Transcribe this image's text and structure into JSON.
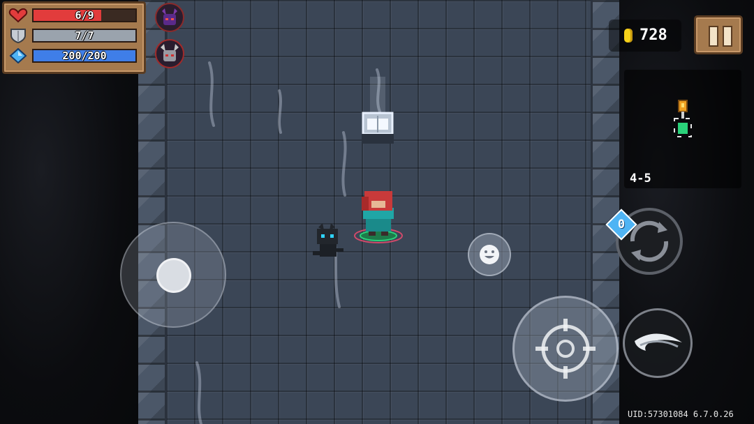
{
  "hud": {
    "health": {
      "text": "6/9",
      "current": 6,
      "max": 9,
      "color": "#e23c3c"
    },
    "armor": {
      "text": "7/7",
      "current": 7,
      "max": 7,
      "color": "#9aa3ad"
    },
    "energy": {
      "text": "200/200",
      "current": 200,
      "max": 200,
      "color": "#3f7ee8"
    },
    "buffs": [
      "purple-demon-helmet-icon",
      "grey-horned-helmet-icon"
    ]
  },
  "coins": {
    "count": "728",
    "icon": "gold-coin-icon",
    "color": "#f6d21a"
  },
  "pause": {
    "icon": "pause-icon"
  },
  "minimap": {
    "level": "4-5"
  },
  "controls": {
    "joystick": "movement-joystick",
    "emote": "smiley-face-icon",
    "weapon_swap": "swap-arrows-icon",
    "skill_count": "0",
    "attack": "crosshair-icon",
    "skill": "slash-skill-icon"
  },
  "footer": {
    "version": "UID:57301084 6.7.0.26"
  },
  "scene": {
    "player": "red-haired-knight",
    "pet": "black-cat",
    "object": "glowing-treasure-chest"
  }
}
